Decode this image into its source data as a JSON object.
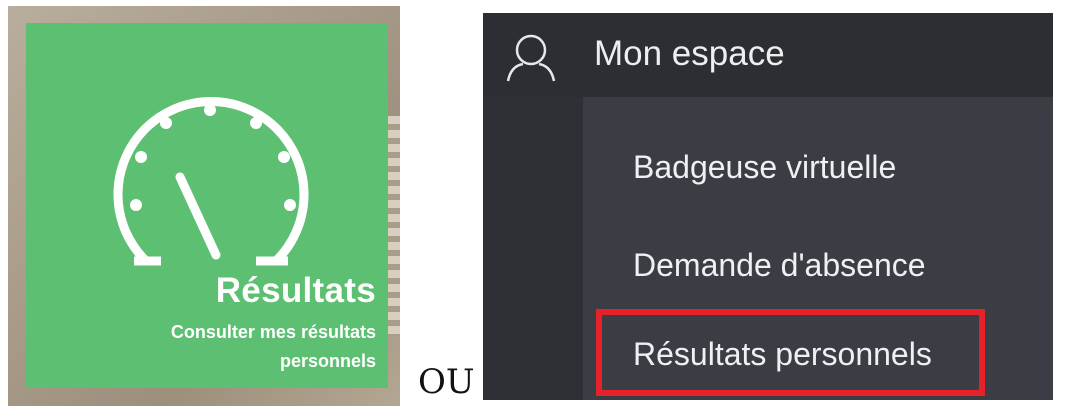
{
  "tile": {
    "title": "Résultats",
    "subtitle": "Consulter mes résultats personnels",
    "icon": "gauge-icon",
    "color": "#5dbf72"
  },
  "separator_text": "OU",
  "menu": {
    "header": {
      "label": "Mon espace",
      "icon": "user-icon"
    },
    "items": [
      {
        "label": "Badgeuse virtuelle"
      },
      {
        "label": "Demande d'absence"
      },
      {
        "label": "Résultats personnels",
        "highlighted": true
      }
    ],
    "highlight_color": "#e5212b"
  }
}
